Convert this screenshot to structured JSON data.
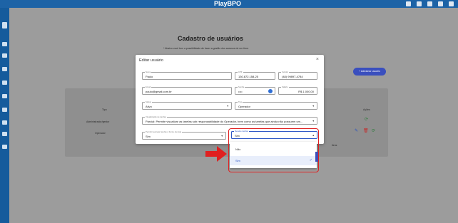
{
  "app": {
    "brand": "PlayBPO"
  },
  "page": {
    "title": "Cadastro de usuários",
    "subtitle": "* Abaixo você tem a possibilidade de fazer a gestão dos acessos de um time.",
    "add_button": "+ Adicionar usuário"
  },
  "table": {
    "headers": {
      "type": "Tipo",
      "actions": "Ações"
    },
    "rows": [
      {
        "type": "Administrador/gestor"
      },
      {
        "type": "Operador"
      }
    ],
    "pager": "ltens"
  },
  "modal": {
    "title": "Editar usuário",
    "close": "×",
    "fields": {
      "nome": {
        "label": "Nome",
        "value": "Paulo"
      },
      "cpf": {
        "label": "CPF",
        "value": "130.872.158-25"
      },
      "celular": {
        "label": "Celular",
        "value": "(48) 99897-4784"
      },
      "email": {
        "label": "Email",
        "value": "paulo@gmail.com.br"
      },
      "senha": {
        "label": "Senha",
        "value": "••••"
      },
      "salario": {
        "label": "Salário",
        "value": "R$ 1.000,00"
      },
      "status": {
        "label": "Status",
        "value": "Ativo"
      },
      "tipo": {
        "label": "Tipo",
        "value": "Operador"
      },
      "visualizacao": {
        "label": "Visualização de tarefas",
        "value": "Parcial: Permite visualizar as tarefas sob responsabilidade do Operador, bem como as tarefas que ainda não possuem um..."
      },
      "permitir_avancar": {
        "label": "Permitir avançar tarefas à frente da data",
        "value": "Sim"
      },
      "recebe_tarefas": {
        "label": "Recebe tarefas",
        "value": "Sim"
      }
    },
    "dropdown": {
      "options": [
        {
          "label": "Não",
          "selected": false
        },
        {
          "label": "Sim",
          "selected": true
        }
      ],
      "check_icon": "✓"
    }
  },
  "colors": {
    "topbar": "#1d63a6",
    "sidebar": "#155b9c",
    "accent": "#3a4fbe",
    "highlight": "#e02020"
  }
}
